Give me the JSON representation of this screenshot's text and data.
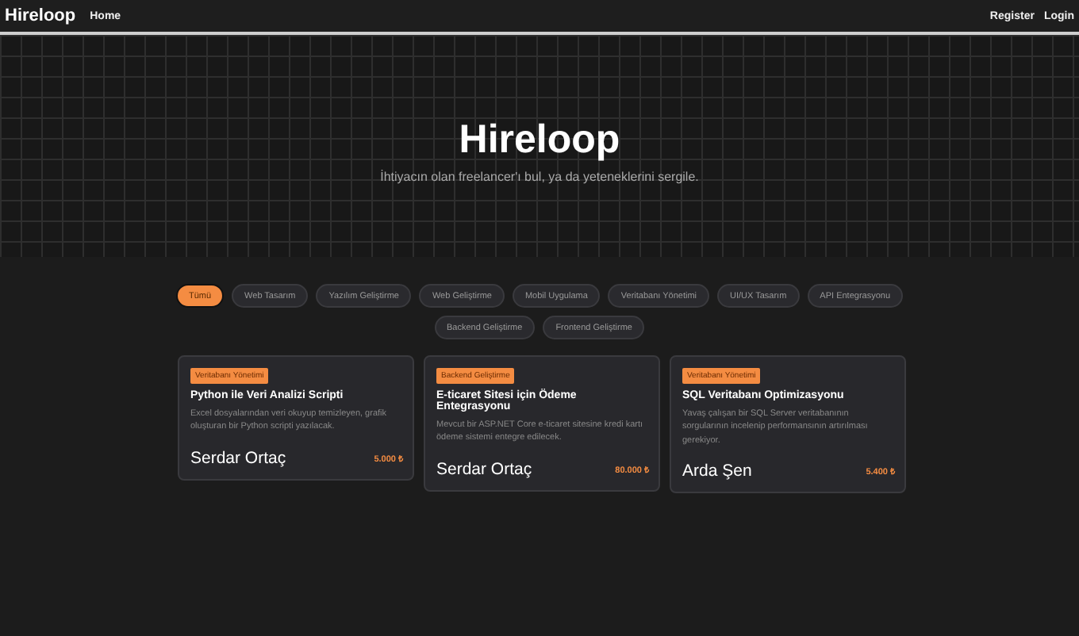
{
  "navbar": {
    "brand": "Hireloop",
    "links": [
      "Home"
    ],
    "auth_links": [
      "Register",
      "Login"
    ]
  },
  "hero": {
    "title": "Hireloop",
    "subtitle": "İhtiyacın olan freelancer'ı bul, ya da yeteneklerini sergile."
  },
  "categories": [
    {
      "label": "Tümü",
      "selected": true
    },
    {
      "label": "Web Tasarım",
      "selected": false
    },
    {
      "label": "Yazılım Geliştirme",
      "selected": false
    },
    {
      "label": "Web Geliştirme",
      "selected": false
    },
    {
      "label": "Mobil Uygulama",
      "selected": false
    },
    {
      "label": "Veritabanı Yönetimi",
      "selected": false
    },
    {
      "label": "UI/UX Tasarım",
      "selected": false
    },
    {
      "label": "API Entegrasyonu",
      "selected": false
    },
    {
      "label": "Backend Geliştirme",
      "selected": false
    },
    {
      "label": "Frontend Geliştirme",
      "selected": false
    }
  ],
  "jobs": [
    {
      "tag": "Veritabanı Yönetimi",
      "title": "Python ile Veri Analizi Scripti",
      "description": "Excel dosyalarından veri okuyup temizleyen, grafik oluşturan bir Python scripti yazılacak.",
      "client": "Serdar Ortaç",
      "price": "5.000 ₺"
    },
    {
      "tag": "Backend Geliştirme",
      "title": "E-ticaret Sitesi için Ödeme Entegrasyonu",
      "description": "Mevcut bir ASP.NET Core e-ticaret sitesine kredi kartı ödeme sistemi entegre edilecek.",
      "client": "Serdar Ortaç",
      "price": "80.000 ₺"
    },
    {
      "tag": "Veritabanı Yönetimi",
      "title": "SQL Veritabanı Optimizasyonu",
      "description": "Yavaş çalışan bir SQL Server veritabanının sorgularının incelenip performansının artırılması gerekiyor.",
      "client": "Arda Şen",
      "price": "5.400 ₺"
    }
  ]
}
